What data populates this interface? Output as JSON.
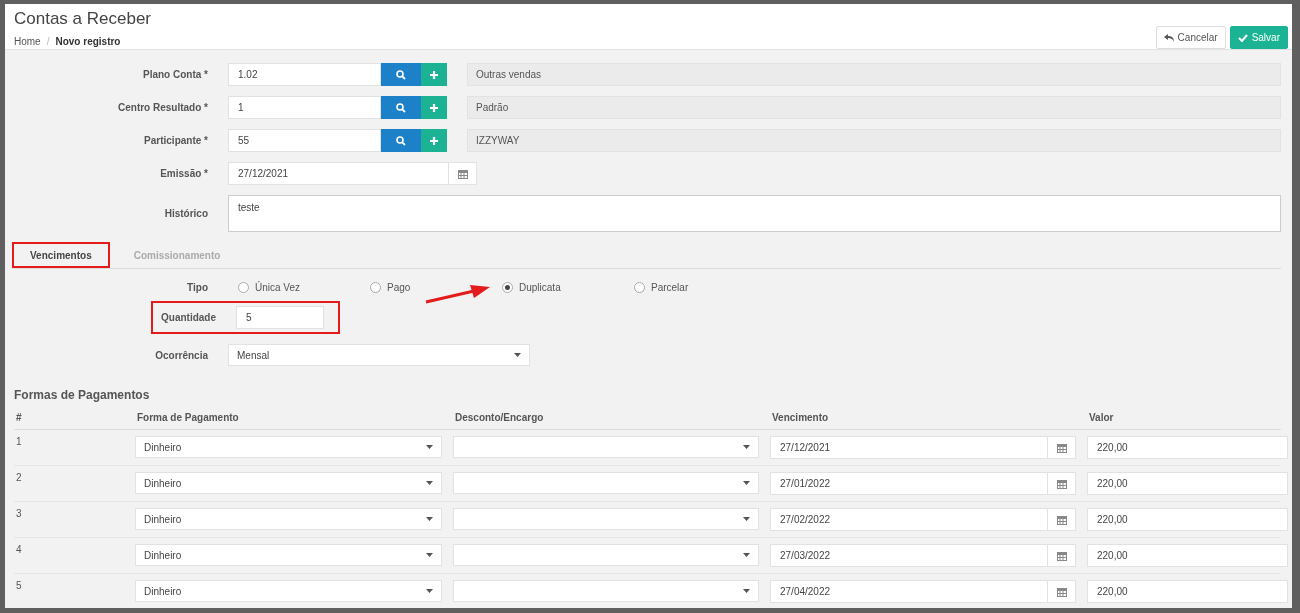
{
  "page": {
    "title": "Contas a Receber",
    "separator": "/",
    "breadcrumb": [
      {
        "label": "Home",
        "current": false
      },
      {
        "label": "Novo registro",
        "current": true
      }
    ]
  },
  "actions": [
    {
      "kind": "cancel",
      "label": "Cancelar"
    },
    {
      "kind": "save",
      "label": "Salvar"
    }
  ],
  "fields": [
    {
      "kind": "lookup",
      "label": "Plano Conta *",
      "value": "1.02",
      "description": "Outras vendas"
    },
    {
      "kind": "lookup",
      "label": "Centro Resultado *",
      "value": "1",
      "description": "Padrão"
    },
    {
      "kind": "lookup",
      "label": "Participante *",
      "value": "55",
      "description": "IZZYWAY"
    },
    {
      "kind": "date",
      "label": "Emissão *",
      "value": "27/12/2021"
    },
    {
      "kind": "textarea",
      "label": "Histórico",
      "value": "teste"
    }
  ],
  "tabs": [
    {
      "label": "Vencimentos",
      "selected": true,
      "highlighted": true
    },
    {
      "label": "Comissionamento",
      "selected": false,
      "highlighted": false
    }
  ],
  "tipo": {
    "label": "Tipo",
    "options": [
      {
        "label": "Única Vez",
        "selected": false
      },
      {
        "label": "Pago",
        "selected": false
      },
      {
        "label": "Duplicata",
        "selected": true
      },
      {
        "label": "Parcelar",
        "selected": false
      }
    ]
  },
  "quantidade": {
    "label": "Quantidade",
    "value": "5",
    "highlighted": true
  },
  "ocorrencia": {
    "label": "Ocorrência",
    "value": "Mensal"
  },
  "payments": {
    "title": "Formas de Pagamentos",
    "columns": [
      "#",
      "Forma de Pagamento",
      "Desconto/Encargo",
      "Vencimento",
      "Valor"
    ],
    "rows": [
      {
        "number": "1",
        "method": "Dinheiro",
        "due": "27/12/2021",
        "amount": "220,00"
      },
      {
        "number": "2",
        "method": "Dinheiro",
        "due": "27/01/2022",
        "amount": "220,00"
      },
      {
        "number": "3",
        "method": "Dinheiro",
        "due": "27/02/2022",
        "amount": "220,00"
      },
      {
        "number": "4",
        "method": "Dinheiro",
        "due": "27/03/2022",
        "amount": "220,00"
      },
      {
        "number": "5",
        "method": "Dinheiro",
        "due": "27/04/2022",
        "amount": "220,00"
      }
    ]
  }
}
